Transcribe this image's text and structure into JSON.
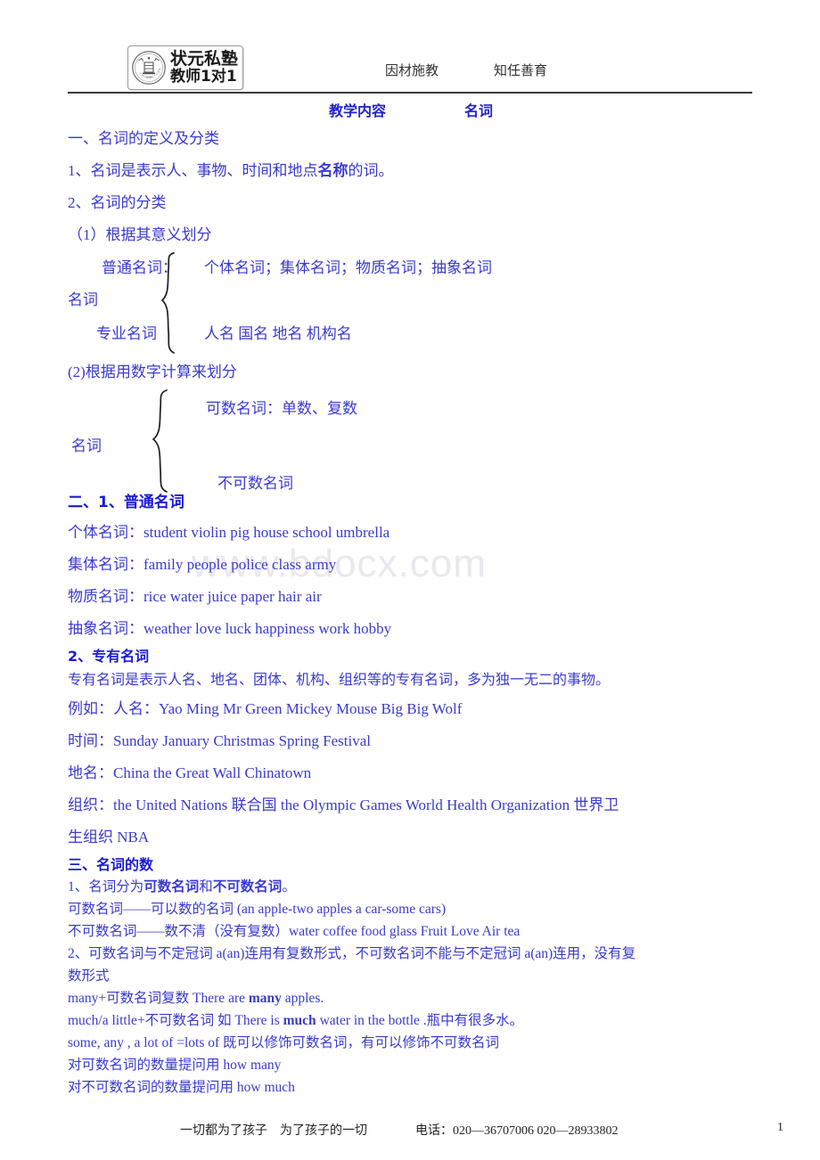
{
  "header": {
    "logo": {
      "line1": "状元私塾",
      "line2": "教师1对1",
      "seal_text": "状元私塾"
    },
    "slogan_left": "因材施教",
    "slogan_right": "知任善育"
  },
  "title": {
    "label": "教学内容",
    "subject": "名词"
  },
  "sections": {
    "s1_heading": "一、名词的定义及分类",
    "s1_item1_a": "1、名词是表示人、事物、时间和地点",
    "s1_item1_bold": "名称",
    "s1_item1_b": "的词。",
    "s1_item2": "2、名词的分类",
    "s1_sub1": "（1）根据其意义划分",
    "diagram1": {
      "root": "名词",
      "branch1_label": "普通名词：",
      "branch1_value": "个体名词；集体名词；物质名词；抽象名词",
      "branch2_label": "专业名词",
      "branch2_value": "人名 国名 地名 机构名"
    },
    "s1_sub2": "(2)根据用数字计算来划分",
    "diagram2": {
      "root": "名词",
      "branch1_value": "可数名词：单数、复数",
      "branch2_value": "不可数名词"
    },
    "s2_heading": "二、1、普通名词",
    "s2_rows": [
      {
        "label": "个体名词：",
        "value": "student    violin      pig    house      school    umbrella"
      },
      {
        "label": "集体名词：",
        "value": "family      people   police    class   army"
      },
      {
        "label": "物质名词：",
        "value": "rice      water   juice   paper   hair   air"
      },
      {
        "label": "抽象名词：",
        "value": "weather   love     luck    happiness    work    hobby"
      }
    ],
    "s2b_heading": "2、专有名词",
    "s2b_desc": "专有名词是表示人名、地名、团体、机构、组织等的专有名词，多为独一无二的事物。",
    "s2b_rows": [
      {
        "label": "例如：人名：",
        "value": "Yao Ming   Mr Green   Mickey Mouse   Big Big Wolf"
      },
      {
        "label": "时间：",
        "value": "Sunday January   Christmas   Spring   Festival"
      },
      {
        "label": "地名：",
        "value": "China    the Great Wall   Chinatown"
      },
      {
        "label": "组织：",
        "value": "the   United   Nations 联合国   the Olympic Games   World   Health   Organization 世界卫"
      },
      {
        "label": "",
        "value": "生组织     NBA"
      }
    ],
    "s3_heading": "三、名词的数",
    "s3_l1_a": "1、名词分为",
    "s3_l1_b1": "可数名词",
    "s3_l1_c": "和",
    "s3_l1_b2": "不可数名词",
    "s3_l1_d": "。",
    "s3_l2": "可数名词——可以数的名词 (an apple-two apples    a car-some cars)",
    "s3_l3": "不可数名词——数不清（没有复数）water coffee    food    glass    Fruit   Love   Air   tea",
    "s3_l4": "2、可数名词与不定冠词 a(an)连用有复数形式，不可数名词不能与不定冠词 a(an)连用，没有复",
    "s3_l5": "数形式",
    "s3_l6_a": "many+可数名词复数    There are ",
    "s3_l6_bold": "many",
    "s3_l6_b": " apples.",
    "s3_l7_a": "much/a little+不可数名词    如 There is ",
    "s3_l7_bold": "much",
    "s3_l7_b": " water in the bottle .瓶中有很多水。",
    "s3_l8": "some, any , a lot of =lots of 既可以修饰可数名词，有可以修饰不可数名词",
    "s3_l9": "对可数名词的数量提问用 how many",
    "s3_l10": "对不可数名词的数量提问用  how much"
  },
  "watermark": "www.bdocx.com",
  "footer": {
    "slogan": "一切都为了孩子　为了孩子的一切",
    "phone": "电话：020—36707006    020—28933802",
    "page": "1"
  },
  "colors": {
    "body_blue": "#3a3ad0",
    "heading_blue": "#1a1ad6",
    "title_blue": "#2222cc",
    "footer_black": "#242424",
    "watermark_gray": "#e9e9ed"
  }
}
